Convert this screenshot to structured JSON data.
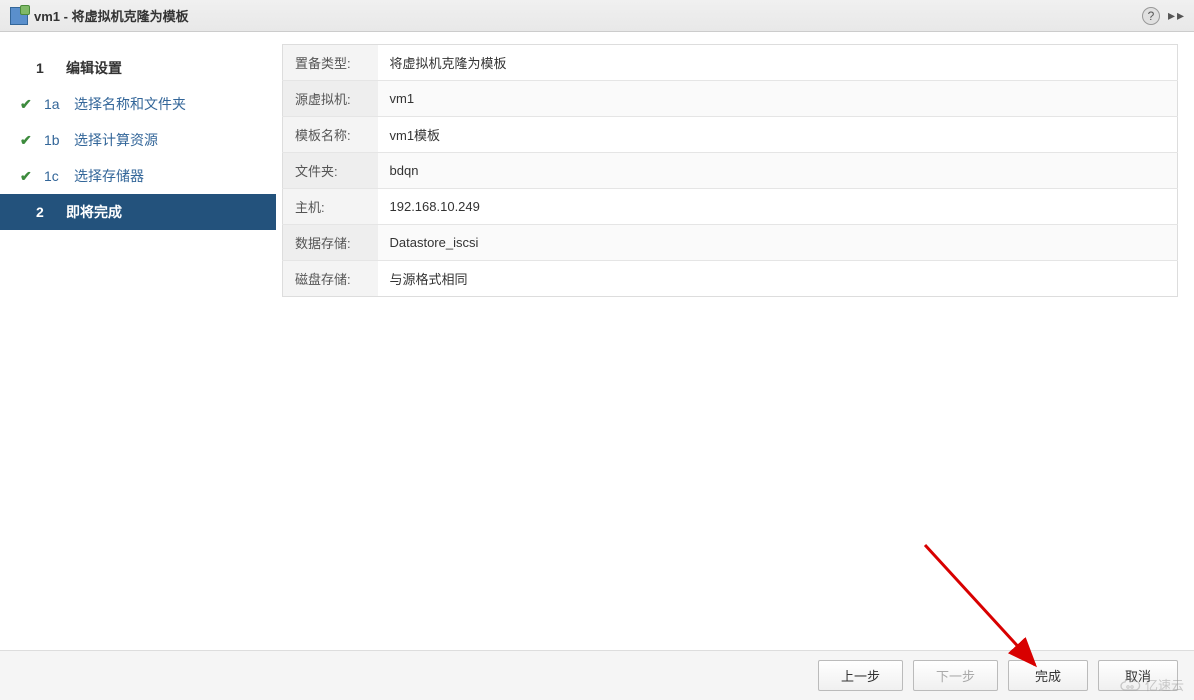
{
  "dialog": {
    "title": "vm1 - 将虚拟机克隆为模板"
  },
  "wizard": {
    "steps": [
      {
        "num": "1",
        "label": "编辑设置"
      },
      {
        "num": "1a",
        "label": "选择名称和文件夹"
      },
      {
        "num": "1b",
        "label": "选择计算资源"
      },
      {
        "num": "1c",
        "label": "选择存储器"
      },
      {
        "num": "2",
        "label": "即将完成"
      }
    ]
  },
  "summary": {
    "rows": [
      {
        "label": "置备类型:",
        "value": "将虚拟机克隆为模板"
      },
      {
        "label": "源虚拟机:",
        "value": "vm1"
      },
      {
        "label": "模板名称:",
        "value": "vm1模板"
      },
      {
        "label": "文件夹:",
        "value": "bdqn"
      },
      {
        "label": "主机:",
        "value": "192.168.10.249"
      },
      {
        "label": "数据存储:",
        "value": "Datastore_iscsi"
      },
      {
        "label": "磁盘存储:",
        "value": "与源格式相同"
      }
    ]
  },
  "footer": {
    "back": "上一步",
    "next": "下一步",
    "finish": "完成",
    "cancel": "取消"
  },
  "watermark": {
    "text": "亿速云"
  }
}
